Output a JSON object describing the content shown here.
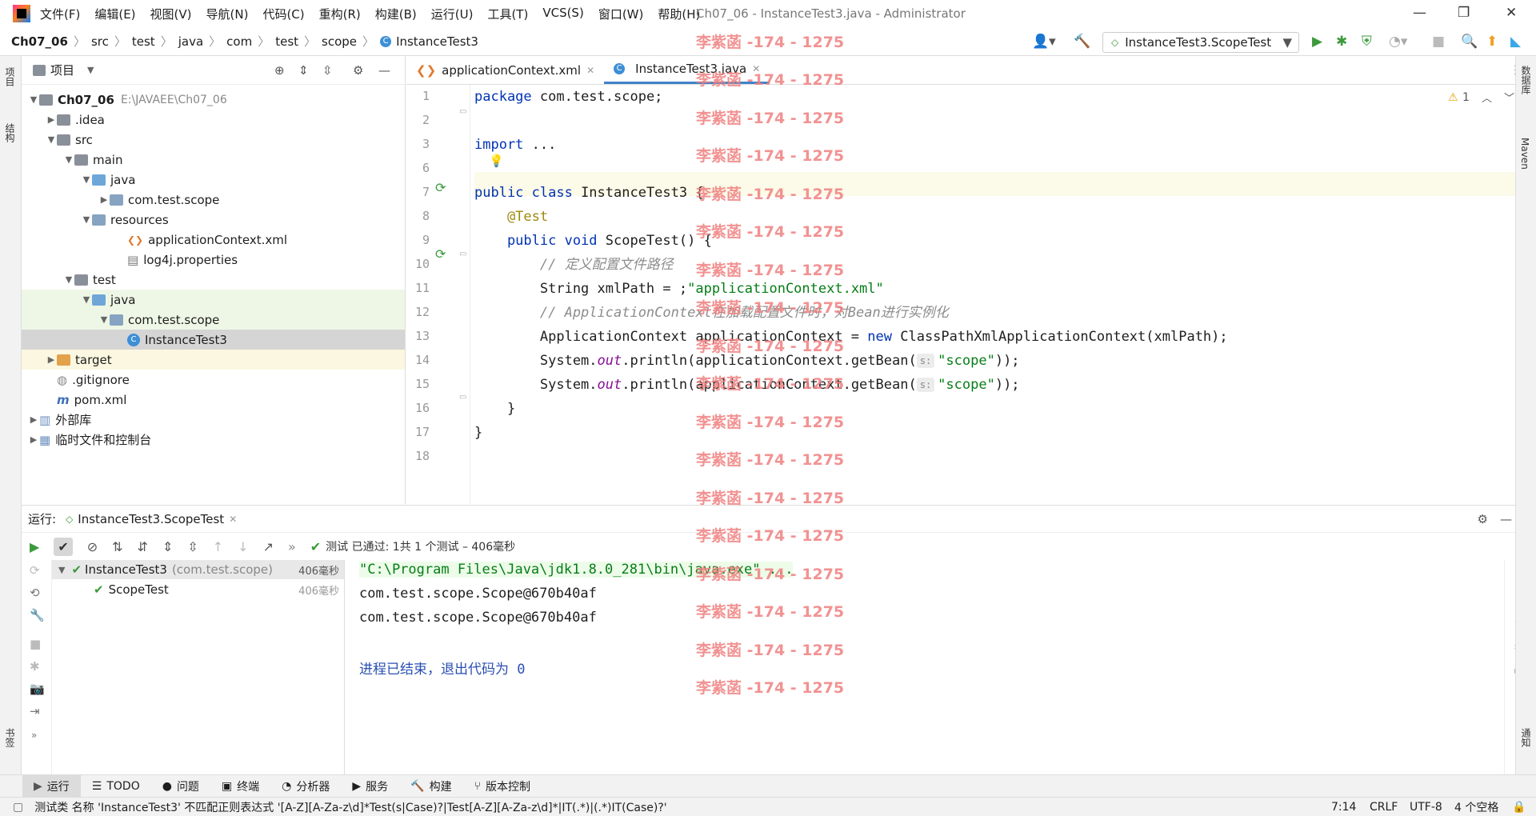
{
  "window": {
    "title": "Ch07_06 - InstanceTest3.java - Administrator"
  },
  "menu": [
    "文件(F)",
    "编辑(E)",
    "视图(V)",
    "导航(N)",
    "代码(C)",
    "重构(R)",
    "构建(B)",
    "运行(U)",
    "工具(T)",
    "VCS(S)",
    "窗口(W)",
    "帮助(H)"
  ],
  "breadcrumb": [
    "Ch07_06",
    "src",
    "test",
    "java",
    "com",
    "test",
    "scope",
    "InstanceTest3"
  ],
  "run_config": "InstanceTest3.ScopeTest",
  "left_strip": {
    "project": "项目",
    "structure": "结构",
    "bookmarks": "书签"
  },
  "right_strip": {
    "database": "数据库",
    "maven": "Maven",
    "notifications": "通知"
  },
  "project_panel": {
    "title": "项目",
    "nodes": [
      {
        "label": "Ch07_06",
        "extra": "E:\\JAVAEE\\Ch07_06",
        "level": 0,
        "expand": "open",
        "icon": "folder",
        "bold": true
      },
      {
        "label": ".idea",
        "level": 1,
        "expand": "closed",
        "icon": "folder"
      },
      {
        "label": "src",
        "level": 1,
        "expand": "open",
        "icon": "folder"
      },
      {
        "label": "main",
        "level": 2,
        "expand": "open",
        "icon": "folder"
      },
      {
        "label": "java",
        "level": 3,
        "expand": "open",
        "icon": "fblue"
      },
      {
        "label": "com.test.scope",
        "level": 4,
        "expand": "closed",
        "icon": "fsrc"
      },
      {
        "label": "resources",
        "level": 3,
        "expand": "open",
        "icon": "fsrc"
      },
      {
        "label": "applicationContext.xml",
        "level": 5,
        "expand": "none",
        "icon": "xml"
      },
      {
        "label": "log4j.properties",
        "level": 5,
        "expand": "none",
        "icon": "props"
      },
      {
        "label": "test",
        "level": 2,
        "expand": "open",
        "icon": "folder"
      },
      {
        "label": "java",
        "level": 3,
        "expand": "open",
        "icon": "fblue",
        "hl": "green"
      },
      {
        "label": "com.test.scope",
        "level": 4,
        "expand": "open",
        "icon": "fsrc",
        "hl": "green"
      },
      {
        "label": "InstanceTest3",
        "level": 5,
        "expand": "none",
        "icon": "class",
        "hl": "sel"
      },
      {
        "label": "target",
        "level": 1,
        "expand": "closed",
        "icon": "forange",
        "hl": "yellow"
      },
      {
        "label": ".gitignore",
        "level": 1,
        "expand": "none",
        "icon": "git"
      },
      {
        "label": "pom.xml",
        "level": 1,
        "expand": "none",
        "icon": "maven"
      },
      {
        "label": "外部库",
        "level": 0,
        "expand": "closed",
        "icon": "lib"
      },
      {
        "label": "临时文件和控制台",
        "level": 0,
        "expand": "closed",
        "icon": "scratch"
      }
    ]
  },
  "editor": {
    "tabs": [
      {
        "label": "applicationContext.xml",
        "active": false
      },
      {
        "label": "InstanceTest3.java",
        "active": true
      }
    ],
    "warnings": "1",
    "line_numbers": [
      "1",
      "2",
      "3",
      "6",
      "7",
      "8",
      "9",
      "10",
      "11",
      "12",
      "13",
      "14",
      "15",
      "16",
      "17",
      "18"
    ],
    "code": [
      {
        "k": "package",
        "t": " com.test.scope;"
      },
      {},
      {
        "k": "import",
        "t": " ..."
      },
      {},
      {
        "k": "public class",
        "t": " InstanceTest3 {"
      },
      {
        "a": "    @Test"
      },
      {
        "k": "    public void",
        "t": " ScopeTest() {"
      },
      {
        "c": "        // 定义配置文件路径"
      },
      {
        "t": "        String xmlPath = ",
        "s": "\"applicationContext.xml\"",
        "e": ";"
      },
      {
        "c": "        // ApplicationContext在加载配置文件时，对Bean进行实例化"
      },
      {
        "t": "        ApplicationContext applicationContext = ",
        "k2": "new",
        "e": " ClassPathXmlApplicationContext(xmlPath);"
      },
      {
        "t": "        System.",
        "i": "out",
        "e": ".println(applicationContext.getBean(",
        "h": "s:",
        "s": "\"scope\"",
        "e2": "));"
      },
      {
        "t": "        System.",
        "i": "out",
        "e": ".println(applicationContext.getBean(",
        "h": "s:",
        "s": "\"scope\"",
        "e2": "));"
      },
      {
        "t": "    }"
      },
      {
        "t": "}"
      },
      {}
    ]
  },
  "run_panel": {
    "label": "运行:",
    "tab": "InstanceTest3.ScopeTest",
    "status": "测试 已通过: 1共 1 个测试 – 406毫秒",
    "tree": [
      {
        "label": "InstanceTest3",
        "pkg": "(com.test.scope)",
        "time": "406毫秒"
      },
      {
        "label": "ScopeTest",
        "time": "406毫秒"
      }
    ],
    "console": [
      "\"C:\\Program Files\\Java\\jdk1.8.0_281\\bin\\java.exe\" ...",
      "com.test.scope.Scope@670b40af",
      "com.test.scope.Scope@670b40af",
      "",
      "进程已结束，退出代码为 0"
    ]
  },
  "bottom_tabs": [
    "运行",
    "TODO",
    "问题",
    "终端",
    "分析器",
    "服务",
    "构建",
    "版本控制"
  ],
  "status_bar": {
    "message": "测试类 名称 'InstanceTest3' 不匹配正则表达式 '[A-Z][A-Za-z\\d]*Test(s|Case)?|Test[A-Z][A-Za-z\\d]*|IT(.*)|(.*)IT(Case)?'",
    "position": "7:14",
    "line_sep": "CRLF",
    "encoding": "UTF-8",
    "indent": "4 个空格"
  },
  "watermark": "李紫菡 -174 - 1275"
}
